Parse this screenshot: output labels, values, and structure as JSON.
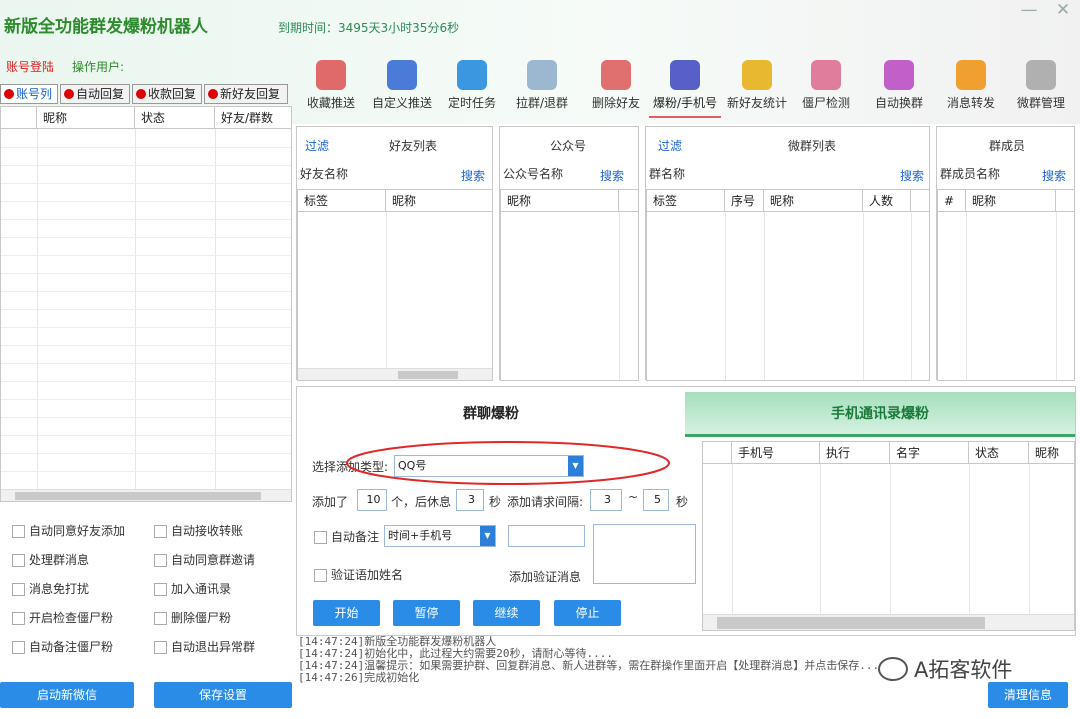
{
  "app": {
    "title": "新版全功能群发爆粉机器人",
    "expire": "到期时间：3495天3小时35分6秒",
    "min_glyph": "—",
    "close_glyph": "✕"
  },
  "left": {
    "account_login": "账号登陆",
    "operator_label": "操作用户:",
    "tabs": [
      "账号列",
      "自动回复",
      "收款回复",
      "新好友回复"
    ],
    "columns": [
      "昵称",
      "状态",
      "好友/群数"
    ],
    "checks": [
      [
        "自动同意好友添加",
        "自动接收转账"
      ],
      [
        "处理群消息",
        "自动同意群邀请"
      ],
      [
        "消息免打扰",
        "加入通讯录"
      ],
      [
        "开启检查僵尸粉",
        "删除僵尸粉"
      ],
      [
        "自动备注僵尸粉",
        "自动退出异常群"
      ]
    ],
    "buttons": {
      "start": "启动新微信",
      "save": "保存设置"
    }
  },
  "toolbar": [
    {
      "label": "收藏推送",
      "icon": "favorite-push-icon",
      "color": "#e06a6a"
    },
    {
      "label": "自定义推送",
      "icon": "custom-push-icon",
      "color": "#4a7bd8"
    },
    {
      "label": "定时任务",
      "icon": "scheduled-task-icon",
      "color": "#3a97e0"
    },
    {
      "label": "拉群/退群",
      "icon": "group-pull-icon",
      "color": "#9bb8d0"
    },
    {
      "label": "删除好友",
      "icon": "delete-friend-icon",
      "color": "#e07070"
    },
    {
      "label": "爆粉/手机号",
      "icon": "phone-fans-icon",
      "color": "#5660c8"
    },
    {
      "label": "新好友统计",
      "icon": "new-friend-stats-icon",
      "color": "#e8b830"
    },
    {
      "label": "僵尸检测",
      "icon": "zombie-detect-icon",
      "color": "#e07d9c"
    },
    {
      "label": "自动换群",
      "icon": "auto-switch-group-icon",
      "color": "#c060c8"
    },
    {
      "label": "消息转发",
      "icon": "message-forward-icon",
      "color": "#f0a030"
    },
    {
      "label": "微群管理",
      "icon": "group-manage-icon",
      "color": "#b0b0b0"
    }
  ],
  "panels": {
    "friends": {
      "filter": "过滤",
      "title": "好友列表",
      "name_label": "好友名称",
      "search": "搜索",
      "columns": [
        "标签",
        "昵称"
      ]
    },
    "official": {
      "title": "公众号",
      "name_label": "公众号名称",
      "search": "搜索",
      "columns": [
        "昵称"
      ]
    },
    "groups": {
      "filter": "过滤",
      "title": "微群列表",
      "name_label": "群名称",
      "search": "搜索",
      "columns": [
        "标签",
        "序号",
        "昵称",
        "人数"
      ]
    },
    "members": {
      "title": "群成员",
      "name_label": "群成员名称",
      "search": "搜索",
      "columns": [
        "#",
        "昵称"
      ]
    }
  },
  "main_tabs": [
    "群聊爆粉",
    "手机通讯录爆粉"
  ],
  "form": {
    "type_label": "选择添加类型:",
    "type_value": "QQ号",
    "added_label": "添加了",
    "added_value": "10",
    "rest_label": "个，后休息",
    "rest_value": "3",
    "sec_label": "秒",
    "interval_label": "添加请求间隔:",
    "interval_min": "3",
    "dash": "~",
    "interval_max": "5",
    "sec_label2": "秒",
    "auto_note": "自动备注",
    "note_value": "时间+手机号",
    "verify_name": "验证语加姓名",
    "add_verify": "添加验证消息",
    "buttons": [
      "开始",
      "暂停",
      "继续",
      "停止"
    ]
  },
  "phone_table": {
    "columns": [
      "手机号",
      "执行",
      "名字",
      "状态",
      "昵称"
    ]
  },
  "log": {
    "lines": [
      "[14:47:24]新版全功能群发爆粉机器人",
      "[14:47:24]初始化中，此过程大约需要20秒，请耐心等待....",
      "[14:47:24]温馨提示：如果需要护群、回复群消息、新人进群等，需在群操作里面开启【处理群消息】并点击保存...",
      "[14:47:26]完成初始化"
    ],
    "clear": "清理信息"
  },
  "watermark": "A拓客软件"
}
